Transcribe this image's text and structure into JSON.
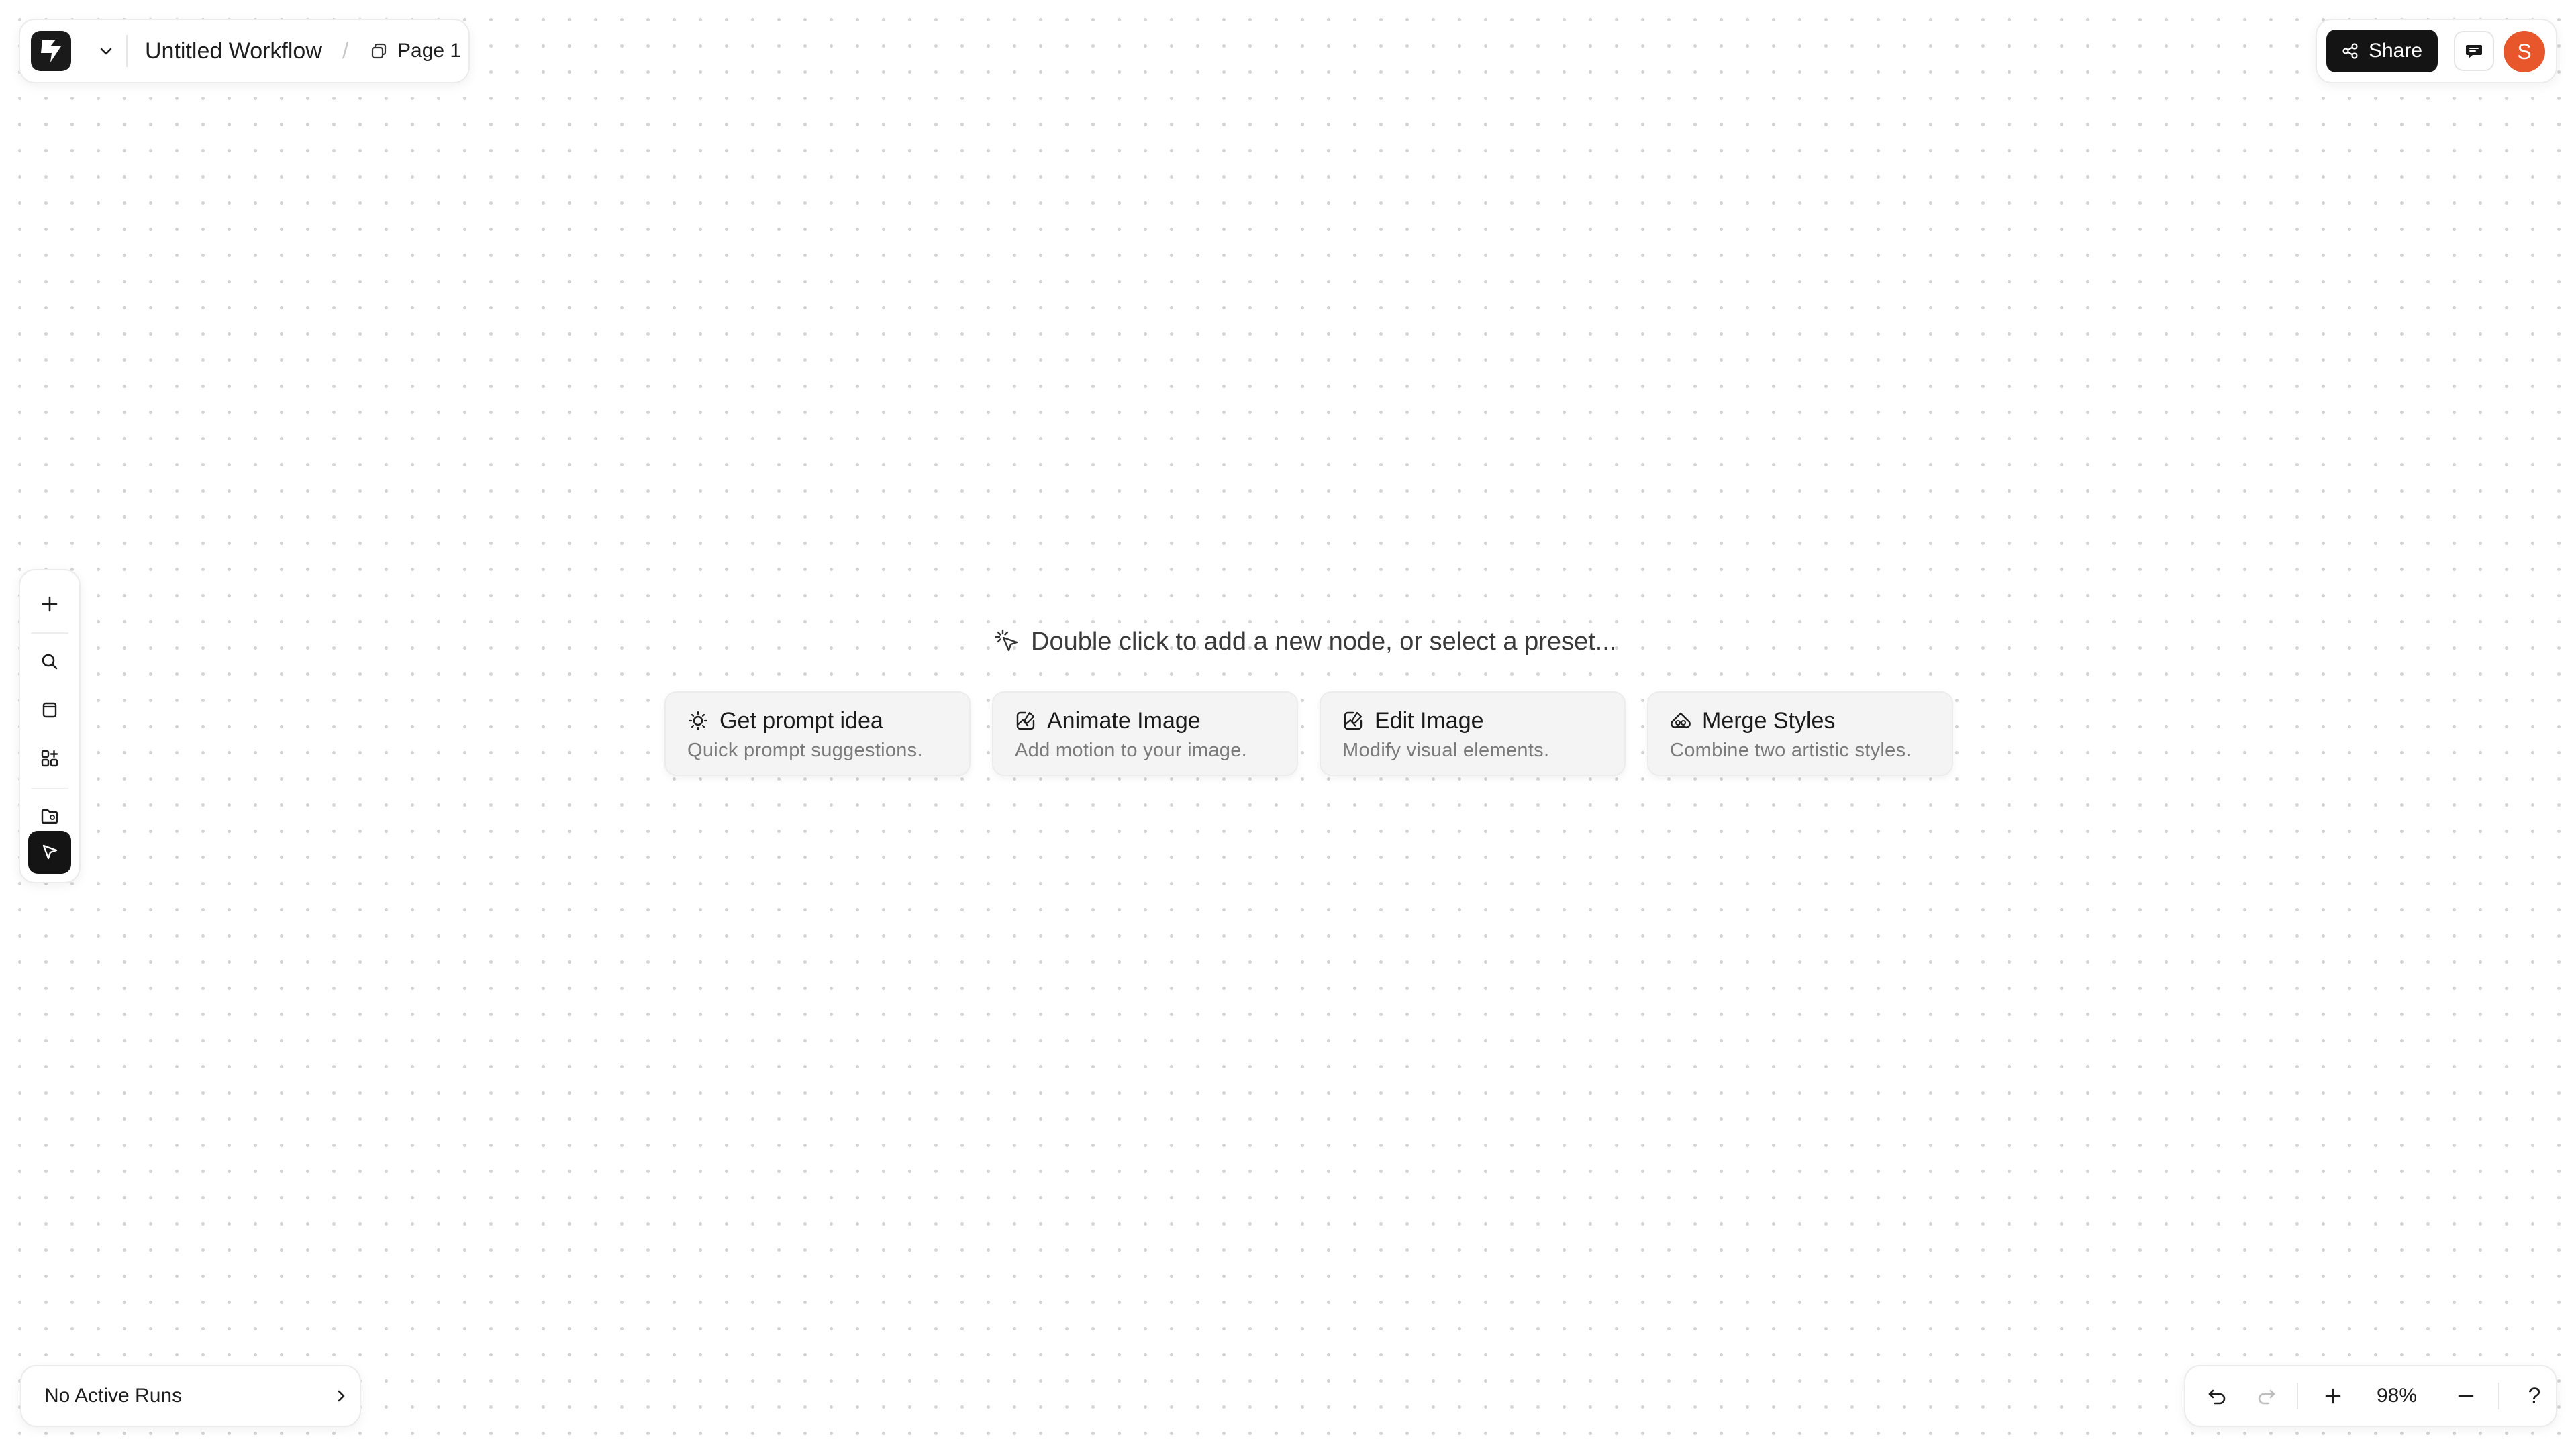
{
  "header": {
    "workflow_title": "Untitled Workflow",
    "separator": "/",
    "page_tab_label": "Page 1",
    "share_label": "Share",
    "avatar_initial": "S"
  },
  "toolbar": {
    "tools": [
      {
        "name": "add",
        "icon": "plus-icon"
      },
      {
        "name": "search",
        "icon": "search-icon"
      },
      {
        "name": "notes",
        "icon": "note-icon"
      },
      {
        "name": "apps",
        "icon": "apps-icon"
      },
      {
        "name": "assets",
        "icon": "folder-image-icon"
      },
      {
        "name": "select",
        "icon": "pointer-icon",
        "active": true
      }
    ]
  },
  "canvas": {
    "hint_text": "Double click to add a new node, or select a preset...",
    "presets": [
      {
        "title": "Get prompt idea",
        "subtitle": "Quick prompt suggestions.",
        "icon": "lightbulb-icon"
      },
      {
        "title": "Animate Image",
        "subtitle": "Add motion to your image.",
        "icon": "image-edit-icon"
      },
      {
        "title": "Edit Image",
        "subtitle": "Modify visual elements.",
        "icon": "image-edit-icon"
      },
      {
        "title": "Merge Styles",
        "subtitle": "Combine two artistic styles.",
        "icon": "merge-icon"
      }
    ]
  },
  "runs": {
    "label": "No Active Runs"
  },
  "zoom": {
    "value": "98%",
    "help": "?"
  },
  "colors": {
    "accent_dark": "#141414",
    "avatar_bg": "#e8572b",
    "preset_bg": "#f4f4f4"
  }
}
